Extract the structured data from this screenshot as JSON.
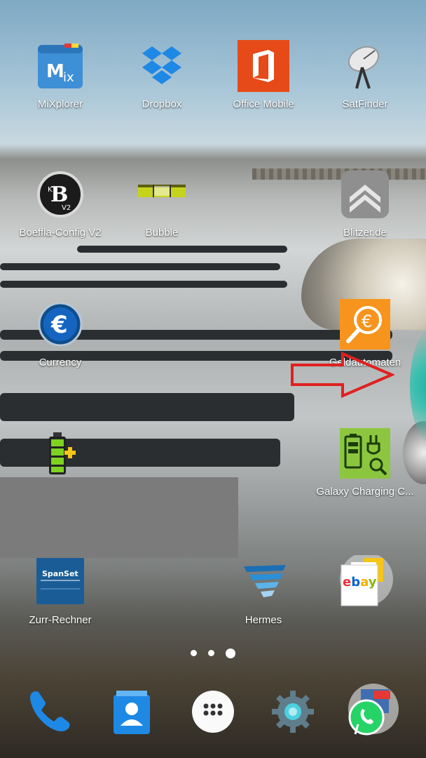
{
  "home": {
    "apps": [
      {
        "label": "MiXplorer",
        "icon": "mixplorer-icon"
      },
      {
        "label": "Dropbox",
        "icon": "dropbox-icon"
      },
      {
        "label": "Office Mobile",
        "icon": "office-icon"
      },
      {
        "label": "SatFinder",
        "icon": "satellite-dish-icon"
      },
      {
        "label": "Boeffla-Config V2",
        "icon": "boeffla-icon"
      },
      {
        "label": "Bubble",
        "icon": "bubble-level-icon"
      },
      {
        "label": "Blitzer.de",
        "icon": "blitzer-icon"
      },
      {
        "label": "Currency",
        "icon": "euro-icon"
      },
      {
        "label": "Geldautomaten",
        "icon": "atm-search-icon"
      },
      {
        "label": "Galaxy Charging C...",
        "icon": "charging-icon"
      },
      {
        "label": "Zurr-Rechner",
        "icon": "spanset-icon"
      },
      {
        "label": "Hermes",
        "icon": "hermes-icon"
      },
      {
        "label": "",
        "icon": "battery-plus-icon"
      },
      {
        "label": "",
        "icon": "ebay-icon"
      }
    ],
    "page_indicator": {
      "count": 3,
      "active": 3
    }
  },
  "dock": [
    {
      "name": "phone",
      "icon": "phone-icon"
    },
    {
      "name": "contacts",
      "icon": "contacts-icon"
    },
    {
      "name": "app-drawer",
      "icon": "app-drawer-icon"
    },
    {
      "name": "settings",
      "icon": "gear-icon"
    },
    {
      "name": "whatsapp",
      "icon": "whatsapp-icon"
    }
  ],
  "colors": {
    "office": "#e64a19",
    "dropbox": "#1e88e5",
    "accent_orange": "#f7941d",
    "annotation_red": "#e02020"
  }
}
